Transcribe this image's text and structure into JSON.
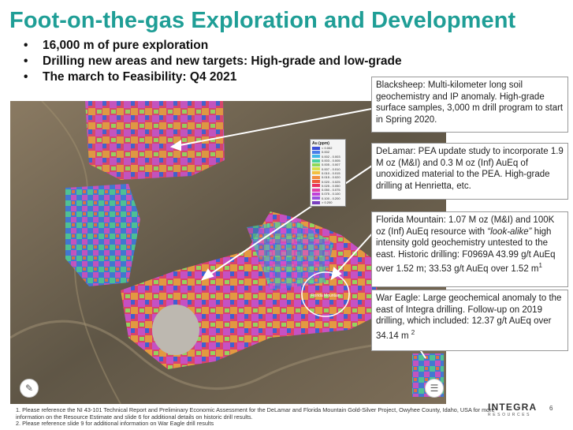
{
  "title": "Foot-on-the-gas Exploration and Development",
  "bullets": [
    "16,000 m of pure exploration",
    "Drilling new areas and new targets: High-grade and low-grade",
    "The march to Feasibility: Q4 2021"
  ],
  "callouts": {
    "blacksheep": "Blacksheep: Multi-kilometer long soil geochemistry and IP anomaly. High-grade surface samples, 3,000 m drill program to start in Spring 2020.",
    "delamar": "DeLamar: PEA update study to incorporate 1.9 M oz (M&I) and 0.3 M oz (Inf) AuEq of unoxidized material to the PEA. High-grade drilling at Henrietta, etc.",
    "florida_pre": "Florida Mountain: 1.07 M oz (M&I) and 100K oz (Inf) AuEq resource with ",
    "florida_italic": "“look-alike”",
    "florida_post": " high intensity gold geochemistry untested to the east. Historic drilling: F0969A 43.99 g/t AuEq over 1.52 m; 33.53 g/t AuEq over 1.52 m",
    "florida_sup": "1",
    "wareagle": "War Eagle: Large geochemical anomaly to the east of Integra drilling. Follow-up on 2019 drilling, which included: 12.37 g/t AuEq over 34.14 m",
    "wareagle_sup": "2"
  },
  "legend": {
    "title": "Au (ppm)",
    "items": [
      {
        "label": "< 0.002",
        "color": "#3b4fd8"
      },
      {
        "label": "0.002",
        "color": "#4a7ee8"
      },
      {
        "label": "0.002 - 0.003",
        "color": "#3fb8e8"
      },
      {
        "label": "0.003 - 0.005",
        "color": "#48d0a0"
      },
      {
        "label": "0.005 - 0.007",
        "color": "#8ed85a"
      },
      {
        "label": "0.007 - 0.010",
        "color": "#d6e04a"
      },
      {
        "label": "0.010 - 0.015",
        "color": "#f2c040"
      },
      {
        "label": "0.015 - 0.020",
        "color": "#f29040"
      },
      {
        "label": "0.020 - 0.025",
        "color": "#ee5a3a"
      },
      {
        "label": "0.025 - 0.050",
        "color": "#e83060"
      },
      {
        "label": "0.050 - 0.075",
        "color": "#e040a8"
      },
      {
        "label": "0.075 - 0.100",
        "color": "#c040d8"
      },
      {
        "label": "0.100 - 0.200",
        "color": "#9a50e0"
      },
      {
        "label": "> 0.200",
        "color": "#7a40c0"
      }
    ]
  },
  "map_label": "Florida Mountain",
  "footnotes": [
    "1. Please  reference the NI 43-101 Technical Report and Preliminary Economic Assessment for the DeLamar and Florida Mountain Gold-Silver Project, Owyhee County, Idaho, USA for more",
    "information on the Resource Estimate and slide 6 for additional details on historic drill results.",
    "2. Please reference slide 9 for additional information on War Eagle drill results"
  ],
  "logo": {
    "name": "INTEGRA",
    "sub": "RESOURCES"
  },
  "page_number": "6",
  "map_buttons": {
    "left": "✎",
    "right": "☰"
  }
}
